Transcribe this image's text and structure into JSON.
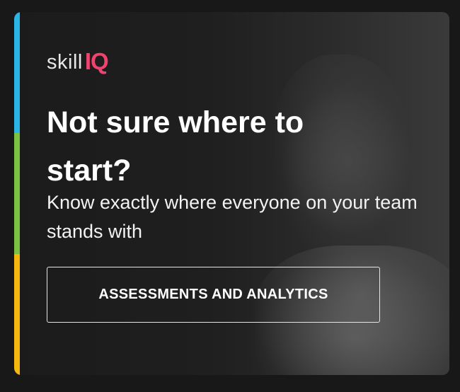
{
  "logo": {
    "prefix": "skill",
    "suffix": "IQ"
  },
  "headline": "Not sure where to start?",
  "subtext": "Know exactly where everyone on your team stands with",
  "cta": {
    "label": "ASSESSMENTS AND ANALYTICS"
  },
  "colors": {
    "accent_blue": "#29b6e6",
    "accent_green": "#7cc242",
    "accent_yellow": "#f6b80f",
    "brand_pink": "#f0436f",
    "background": "#1c1c1c"
  },
  "background_image": "person-photo-grayscale"
}
